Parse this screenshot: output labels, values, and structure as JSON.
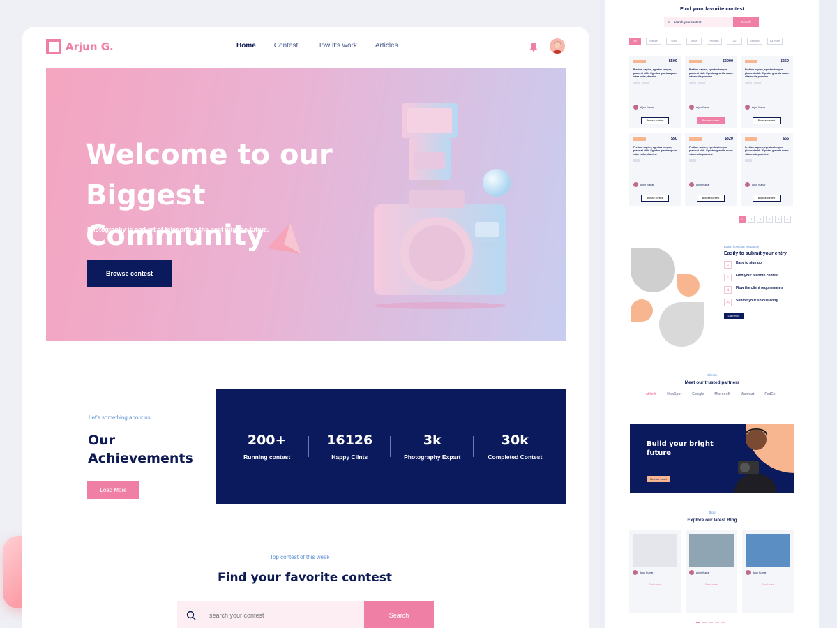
{
  "brand": {
    "name": "Arjun G."
  },
  "nav": {
    "items": [
      "Home",
      "Contest",
      "How it's work",
      "Articles"
    ]
  },
  "hero": {
    "title": "Welcome to our Biggest Community",
    "subtitle": "Photography is and art of teleporting the past into the future.",
    "cta": "Browse contest"
  },
  "about": {
    "tag": "Let's something about us",
    "title": "Our Achievements",
    "button": "Load More"
  },
  "stats": [
    {
      "value": "200+",
      "label": "Running contest"
    },
    {
      "value": "16126",
      "label": "Happy Clints"
    },
    {
      "value": "3k",
      "label": "Photography Expart"
    },
    {
      "value": "30k",
      "label": "Completed Contest"
    }
  ],
  "contest": {
    "tag": "Top contest of this week",
    "title": "Find your favorite contest",
    "search_placeholder": "search your contest",
    "search_button": "Search"
  },
  "right": {
    "contest_title": "Find your favorite contest",
    "search_placeholder": "search your contest",
    "search_button": "Search",
    "filters": [
      "All",
      "Nature",
      "Wild",
      "Model",
      "Product",
      "3D",
      "Fashion",
      "All more"
    ],
    "cards": [
      {
        "price": "$500",
        "button": "Browse contest",
        "primary": false
      },
      {
        "price": "$2000",
        "button": "Browse contest",
        "primary": true
      },
      {
        "price": "$250",
        "button": "Browse contest",
        "primary": false
      },
      {
        "price": "$50",
        "button": "Browse contest",
        "primary": false
      },
      {
        "price": "$320",
        "button": "Browse contest",
        "primary": false
      },
      {
        "price": "$65",
        "button": "Browse contest",
        "primary": false
      }
    ],
    "card_text": "Pretium sapien, egestas tempor, placerat nibh. Egestas gravida quam vitae nulla pharetra.",
    "card_author": "Arjun Kumar",
    "pages": [
      "1",
      "2",
      "3",
      "4",
      "5",
      ">"
    ],
    "apply": {
      "tag": "Learn how can you apply",
      "title": "Easily to submit your entry",
      "steps": [
        {
          "icon": "☺",
          "title": "Easy to sign up"
        },
        {
          "icon": "⌕",
          "title": "Find your favorite contest"
        },
        {
          "icon": "⇅",
          "title": "Flow the client requirements"
        },
        {
          "icon": "◷",
          "title": "Submit your unique entry"
        }
      ],
      "button": "Load more"
    },
    "partners": {
      "tag": "Clients",
      "title": "Meet our trusted partners",
      "logos": [
        "airbnb",
        "HubSpot",
        "Google",
        "Microsoft",
        "Walmart",
        "FedEx"
      ]
    },
    "banner": {
      "title": "Build your bright future",
      "button": "Meet our expert"
    },
    "blog": {
      "tag": "Blog",
      "title": "Explore our latest Blog",
      "author": "Arjun Kumar",
      "read_more": "Read more"
    }
  },
  "colors": {
    "navy": "#0b1a5c",
    "pink": "#ef7fa4",
    "peach": "#f7b68f"
  }
}
